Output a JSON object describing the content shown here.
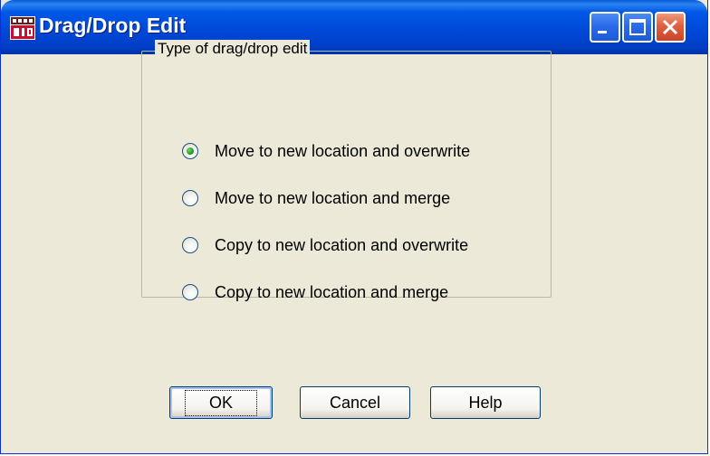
{
  "window": {
    "title": "Drag/Drop Edit",
    "controls": {
      "minimize_icon": "minimize-icon",
      "maximize_icon": "maximize-icon",
      "close_icon": "close-icon"
    },
    "app_icon": "app-icon"
  },
  "group": {
    "label": "Type of drag/drop edit",
    "options": [
      {
        "label": "Move to new location and overwrite",
        "checked": true
      },
      {
        "label": "Move to new location and merge",
        "checked": false
      },
      {
        "label": "Copy to new location and overwrite",
        "checked": false
      },
      {
        "label": "Copy to new location and merge",
        "checked": false
      }
    ]
  },
  "buttons": {
    "ok": "OK",
    "cancel": "Cancel",
    "help": "Help"
  },
  "colors": {
    "titlebar": "#0058e6",
    "dialog_bg": "#ece9d8",
    "close_button": "#e06040"
  }
}
